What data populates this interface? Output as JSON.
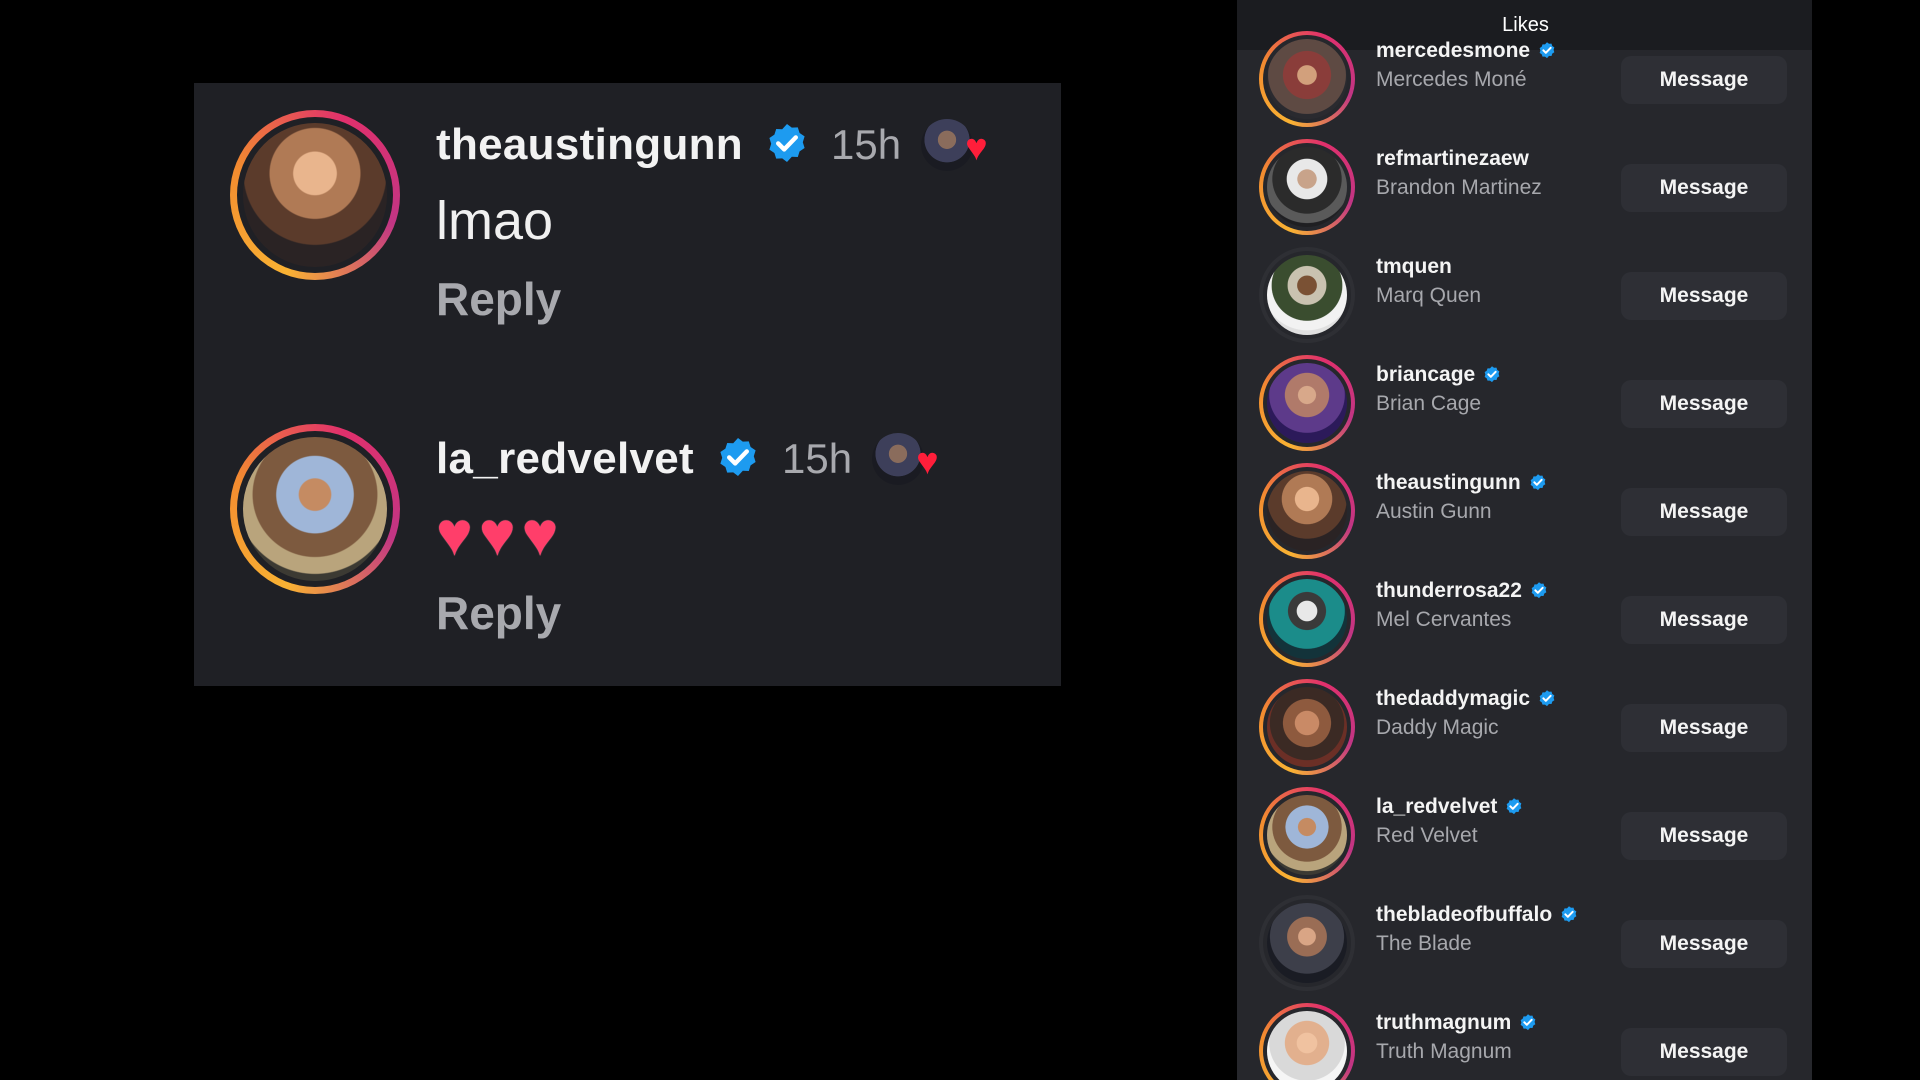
{
  "comments": [
    {
      "username": "theaustingunn",
      "time": "15h",
      "text": "lmao",
      "reply_label": "Reply",
      "avatar": "theaustingunn-avatar",
      "liked_by_author_icon": "author-liked-heart-icon"
    },
    {
      "username": "la_redvelvet",
      "time": "15h",
      "text": "❤️❤️❤️",
      "reply_label": "Reply",
      "avatar": "la_redvelvet-avatar",
      "liked_by_author_icon": "author-liked-heart-icon"
    }
  ],
  "likes": {
    "title": "Likes",
    "message_label": "Message",
    "users": [
      {
        "username": "mercedesmone",
        "full_name": "Mercedes Moné",
        "verified": true
      },
      {
        "username": "refmartinezaew",
        "full_name": "Brandon Martinez",
        "verified": false
      },
      {
        "username": "tmquen",
        "full_name": "Marq Quen",
        "verified": false
      },
      {
        "username": "briancage",
        "full_name": "Brian Cage",
        "verified": true
      },
      {
        "username": "theaustingunn",
        "full_name": "Austin Gunn",
        "verified": true
      },
      {
        "username": "thunderrosa22",
        "full_name": "Mel Cervantes",
        "verified": true
      },
      {
        "username": "thedaddymagic",
        "full_name": "Daddy Magic",
        "verified": true
      },
      {
        "username": "la_redvelvet",
        "full_name": "Red Velvet",
        "verified": true
      },
      {
        "username": "thebladeofbuffalo",
        "full_name": "The Blade",
        "verified": true
      },
      {
        "username": "truthmagnum",
        "full_name": "Truth Magnum",
        "verified": true
      }
    ]
  },
  "colors": {
    "background": "#000000",
    "card": "#1f2025",
    "panel": "#26272c",
    "verified": "#1d9bf0",
    "heart": "#ff1e3a",
    "muted_text": "#a8a9ae"
  }
}
